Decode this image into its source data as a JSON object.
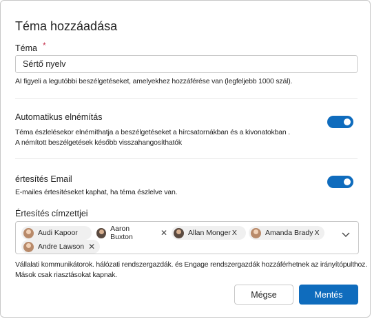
{
  "dialog": {
    "title": "Téma hozzáadása",
    "topic": {
      "label": "Téma",
      "required_mark": "*",
      "value": "Sértő nyelv",
      "help": "AI figyeli a legutóbbi beszélgetéseket, amelyekhez hozzáférése van (legfeljebb 1000 szál)."
    },
    "auto_mute": {
      "label": "Automatikus elnémítás",
      "enabled": true,
      "help_line1": "Téma észlelésekor elnémíthatja a beszélgetéseket a hírcsatornákban és a kivonatokban .",
      "help_line2": "A némított beszélgetések később visszahangosíthatók"
    },
    "email_notify": {
      "label": "értesítés Email",
      "enabled": true,
      "help": "E-mailes értesítéseket kaphat, ha téma észlelve van."
    },
    "recipients": {
      "label": "Értesítés címzettjei",
      "chips": [
        {
          "name": "Audi Kapoor",
          "remove": ""
        },
        {
          "name": "Aaron Buxton",
          "remove": "✕"
        },
        {
          "name": "Allan Monger",
          "remove": "X"
        },
        {
          "name": "Amanda Brady",
          "remove": "X"
        },
        {
          "name": "Andre Lawson",
          "remove": "✕"
        }
      ]
    },
    "footer_help_line1": "Vállalati kommunikátorok. hálózati rendszergazdák. és Engage rendszergazdák hozzáférhetnek az irányítópulthoz.",
    "footer_help_line2": "Mások csak riasztásokat kapnak.",
    "buttons": {
      "cancel": "Mégse",
      "save": "Mentés"
    },
    "colors": {
      "accent": "#0f6cbd",
      "required": "#c4314b"
    }
  }
}
